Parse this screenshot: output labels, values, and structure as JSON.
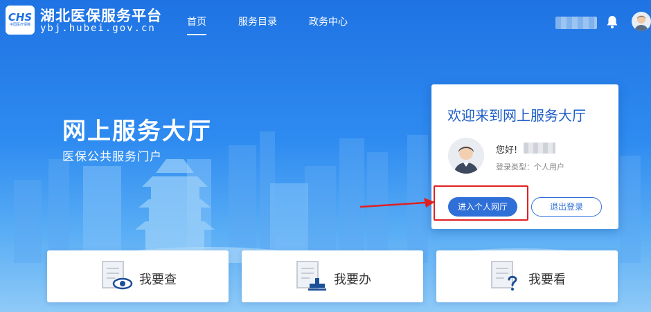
{
  "header": {
    "logo_text": "CHS",
    "logo_sub": "中国医疗保障",
    "title": "湖北医保服务平台",
    "domain": "ybj.hubei.gov.cn",
    "nav": [
      {
        "label": "首页",
        "active": true
      },
      {
        "label": "服务目录",
        "active": false
      },
      {
        "label": "政务中心",
        "active": false
      }
    ]
  },
  "hero": {
    "title": "网上服务大厅",
    "subtitle": "医保公共服务门户"
  },
  "welcome_card": {
    "title": "欢迎来到网上服务大厅",
    "greeting": "您好!",
    "login_type": "登录类型：个人用户",
    "enter_button": "进入个人网厅",
    "logout_button": "退出登录"
  },
  "actions": [
    {
      "label": "我要查",
      "icon": "eye-document-icon"
    },
    {
      "label": "我要办",
      "icon": "stamp-document-icon"
    },
    {
      "label": "我要看",
      "icon": "question-document-icon"
    }
  ],
  "colors": {
    "primary": "#2f6fd8",
    "title_blue": "#1e5ec8",
    "highlight": "#e02020"
  }
}
